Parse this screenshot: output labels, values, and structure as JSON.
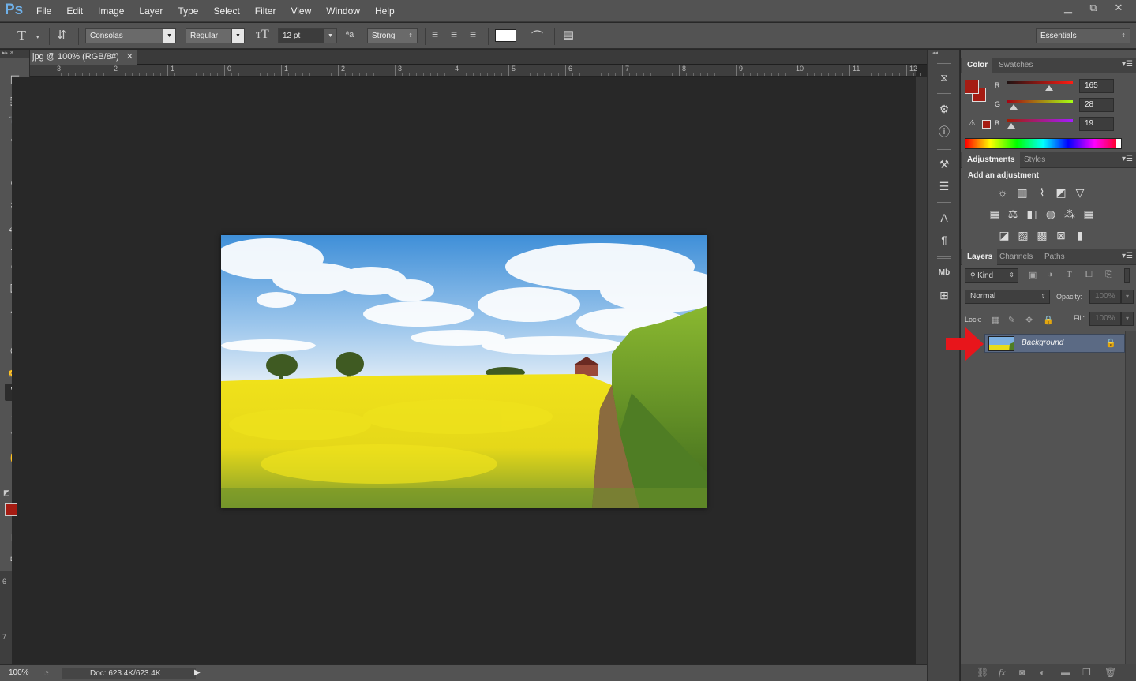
{
  "app": {
    "logo": "Ps"
  },
  "menu": [
    "File",
    "Edit",
    "Image",
    "Layer",
    "Type",
    "Select",
    "Filter",
    "View",
    "Window",
    "Help"
  ],
  "window_controls": {
    "minimize": "▁",
    "restore": "⧉",
    "close": "✕"
  },
  "options": {
    "tool_glyph": "T",
    "font_family": "Consolas",
    "font_style": "Regular",
    "font_size": "12 pt",
    "aa_glyph": "ªa",
    "antialias": "Strong",
    "text_color": "#ffffff",
    "workspace": "Essentials"
  },
  "document": {
    "tab_title": "jpg @ 100% (RGB/8#)",
    "tab_close": "✕",
    "ruler_labels": [
      "3",
      "2",
      "1",
      "0",
      "1",
      "2",
      "3",
      "4",
      "5",
      "6",
      "7",
      "8",
      "9",
      "10",
      "11",
      "12"
    ],
    "vruler_labels": [
      "6",
      "7"
    ]
  },
  "status": {
    "zoom": "100%",
    "doc": "Doc: 623.4K/623.4K",
    "arrow": "▶"
  },
  "tools": {
    "header": "▸▸ ✕",
    "foreground": "#a51c13",
    "background": "#a51c13",
    "selected": "type-tool",
    "mini_swap": "⇆",
    "mini_default": "◩"
  },
  "color_panel": {
    "tabs": [
      "Color",
      "Swatches"
    ],
    "r_label": "R",
    "r": "165",
    "r_level": 0.647,
    "g_label": "G",
    "g": "28",
    "g_level": 0.11,
    "b_label": "B",
    "b": "19",
    "b_level": 0.075,
    "foreground": "#a51c13",
    "warning": "⚠"
  },
  "adjustments_panel": {
    "tabs": [
      "Adjustments",
      "Styles"
    ],
    "heading": "Add an adjustment"
  },
  "layers_panel": {
    "tabs": [
      "Layers",
      "Channels",
      "Paths"
    ],
    "kind": "Kind",
    "blend_mode": "Normal",
    "opacity_label": "Opacity:",
    "opacity": "100%",
    "lock_label": "Lock:",
    "fill_label": "Fill:",
    "fill": "100%",
    "layers": [
      {
        "name": "Background",
        "locked": true
      }
    ]
  },
  "annotation": {
    "arrow_color": "#e8151b"
  }
}
